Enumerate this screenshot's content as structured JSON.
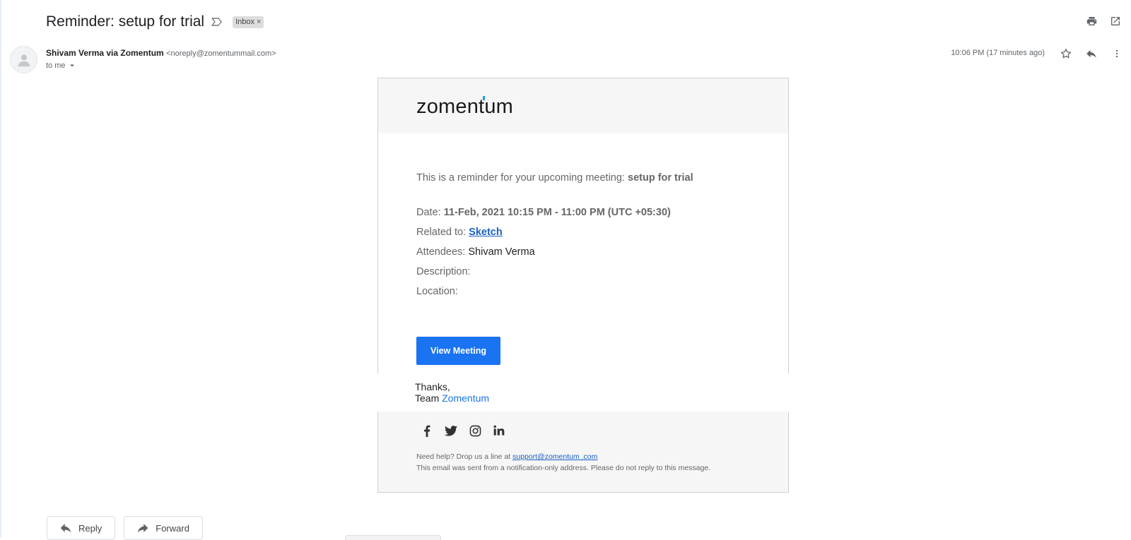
{
  "email": {
    "subject": "Reminder: setup for trial",
    "label_chip": "Inbox",
    "label_chip_close": "×",
    "sender_name": "Shivam Verma via Zomentum",
    "sender_email": "<noreply@zomentummail.com>",
    "to_line": "to me",
    "time": "10:06 PM (17 minutes ago)"
  },
  "card": {
    "logo_text_pre": "zomen",
    "logo_text_tick": "t",
    "logo_text_post": "um",
    "intro_prefix": "This is a reminder for your upcoming meeting: ",
    "intro_meeting": "setup for trial",
    "date_label": "Date: ",
    "date_value": "11-Feb, 2021 10:15 PM - 11:00 PM (UTC +05:30)",
    "related_label": "Related to: ",
    "related_value": "Sketch",
    "attendees_label": "Attendees: ",
    "attendees_value": "Shivam Verma",
    "description_label": "Description:",
    "location_label": "Location:",
    "view_button": "View Meeting",
    "thanks_line": "Thanks,",
    "team_prefix": "Team ",
    "team_brand": "Zomentum",
    "help_prefix": "Need help? Drop us a line at ",
    "help_email": "support@zomentum .com",
    "notice": "This email was sent from a notification-only address. Please do not reply to this message."
  },
  "bottom_actions": {
    "reply": "Reply",
    "forward": "Forward"
  },
  "icons": {
    "top": [
      "print-icon",
      "open-in-new-window-icon"
    ],
    "message": [
      "star-icon",
      "reply-icon",
      "more-vert-icon"
    ],
    "social": [
      "facebook-icon",
      "twitter-icon",
      "instagram-icon",
      "linkedin-icon"
    ]
  },
  "colors": {
    "view_button_bg": "#1a73f0",
    "link": "#1a5fc4",
    "brand": "#1a73e8",
    "logo_accent": "#1e9bd7"
  }
}
